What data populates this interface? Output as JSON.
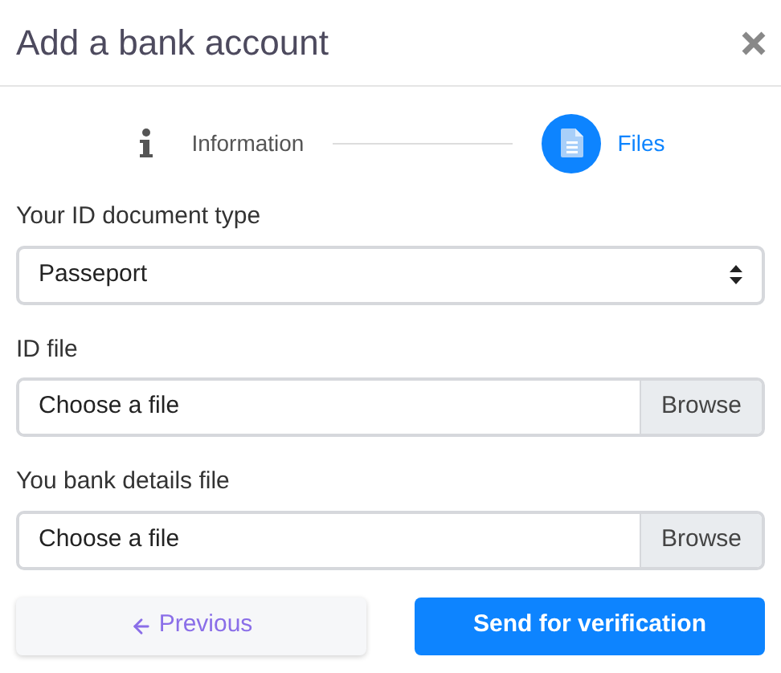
{
  "title": "Add a bank account",
  "steps": [
    {
      "kind": "info",
      "label": "Information",
      "selected": false
    },
    {
      "kind": "file",
      "label": "Files",
      "selected": true
    }
  ],
  "fields": [
    {
      "kind": "select",
      "label": "Your ID document type",
      "value": "Passeport"
    },
    {
      "kind": "file",
      "label": "ID file",
      "value": "Choose a file",
      "button": "Browse"
    },
    {
      "kind": "file",
      "label": "You bank details file",
      "value": "Choose a file",
      "button": "Browse"
    }
  ],
  "buttons": {
    "previous": "Previous",
    "submit": "Send for verification"
  }
}
